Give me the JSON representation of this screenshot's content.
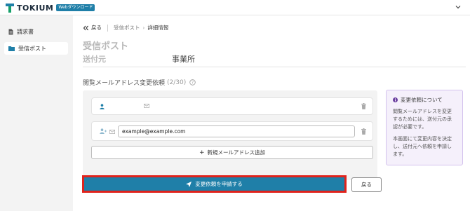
{
  "header": {
    "logo_text": "TOKIUM",
    "logo_badge": "Webダウンロード",
    "brand_color": "#1f7fa8",
    "accent_green": "#16a06a"
  },
  "sidebar": {
    "items": [
      {
        "label": "請求書",
        "icon": "document-icon",
        "active": false
      },
      {
        "label": "受信ポスト",
        "icon": "folder-icon",
        "active": true
      }
    ]
  },
  "breadcrumb": {
    "back_label": "戻る",
    "items": [
      "受信ポスト",
      "詳細情報"
    ]
  },
  "page": {
    "title": "受信ポスト",
    "sender_label": "送付元",
    "sender_value": "事業所"
  },
  "section": {
    "title": "閲覧メールアドレス変更依頼",
    "count": "(2/30)"
  },
  "rows": [
    {
      "email": ""
    },
    {
      "email": "example@example.com"
    }
  ],
  "add_button_label": "新規メールアドレス追加",
  "info": {
    "title": "変更依頼について",
    "text1": "閲覧メールアドレスを変更するためには、送付元の承認が必要です。",
    "text2": "本画面にて変更内容を決定し、送付元へ依頼を申請します。",
    "bg_color": "#f5f0fb",
    "border_color": "#d4c2ee"
  },
  "actions": {
    "submit_label": "変更依頼を申請する",
    "back_label": "戻る",
    "highlight_color": "#e0231c"
  }
}
